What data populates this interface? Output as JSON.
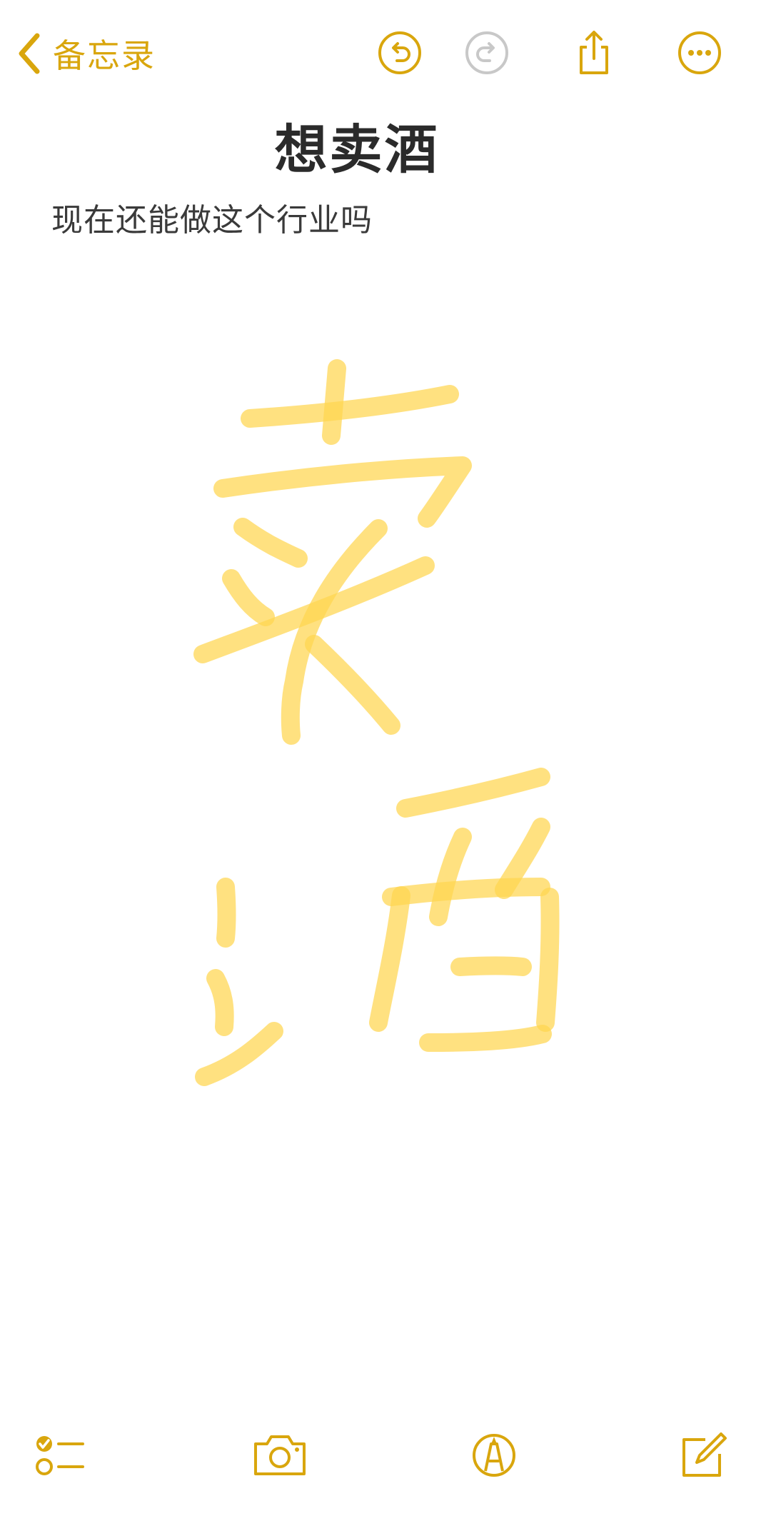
{
  "nav": {
    "back_label": "备忘录",
    "back_icon": "chevron-left-icon",
    "undo_icon": "undo-icon",
    "redo_icon": "redo-icon",
    "share_icon": "share-icon",
    "more_icon": "ellipsis-circle-icon"
  },
  "note": {
    "title": "想卖酒",
    "body": "现在还能做这个行业吗",
    "drawing_icon": "handwritten-drawing"
  },
  "toolbar": {
    "checklist_icon": "checklist-icon",
    "camera_icon": "camera-icon",
    "markup_icon": "markup-pen-icon",
    "compose_icon": "compose-icon"
  },
  "colors": {
    "accent": "#d9a60d",
    "ink": "#ffd54f",
    "disabled": "#c8c8c8",
    "title": "#2b2b2b",
    "body": "#3a3a3a"
  }
}
